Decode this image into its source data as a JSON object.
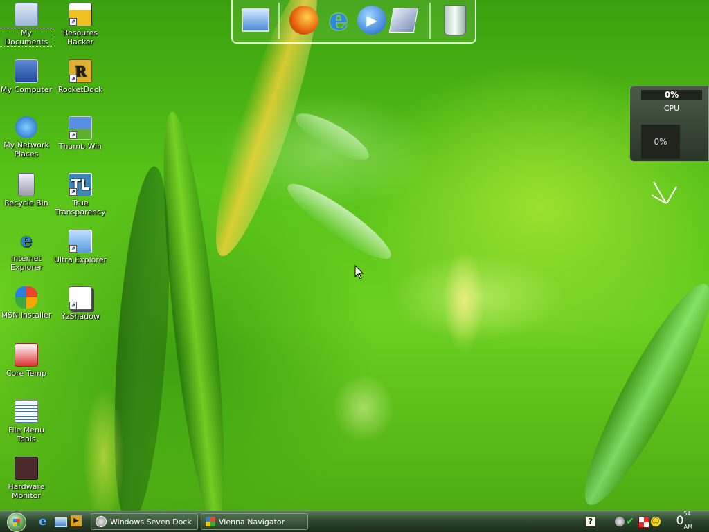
{
  "desktop": {
    "icons_col1": [
      {
        "label": "My Documents"
      },
      {
        "label": "My Computer"
      },
      {
        "label": "My Network Places"
      },
      {
        "label": "Recycle Bin"
      },
      {
        "label": "Internet Explorer"
      },
      {
        "label": "MSN Installer"
      },
      {
        "label": "Core Temp"
      },
      {
        "label": "File Menu Tools"
      },
      {
        "label": "Hardware Monitor"
      }
    ],
    "icons_col2": [
      {
        "label": "Resoures Hacker"
      },
      {
        "label": "RocketDock"
      },
      {
        "label": "Thumb Win"
      },
      {
        "label": "True Transparency"
      },
      {
        "label": "Ultra Explorer"
      },
      {
        "label": "YzShadow"
      }
    ]
  },
  "dock": {
    "items": [
      {
        "icon": "monitor-icon"
      },
      {
        "icon": "firefox-icon"
      },
      {
        "icon": "internet-explorer-icon"
      },
      {
        "icon": "media-player-icon"
      },
      {
        "icon": "control-panel-icon"
      },
      {
        "icon": "recycle-bin-icon"
      }
    ]
  },
  "cpu_gadget": {
    "top_value": "0%",
    "label": "CPU",
    "bottom_value": "0%"
  },
  "taskbar": {
    "tasks": [
      {
        "label": "Windows Seven Dock"
      },
      {
        "label": "Vienna Navigator"
      }
    ],
    "clock": {
      "hour": "0",
      "minute": "54",
      "ampm": "AM"
    },
    "help_label": "?"
  },
  "colors": {
    "wallpaper_green": "#58c318",
    "taskbar": "#2f4a30"
  }
}
